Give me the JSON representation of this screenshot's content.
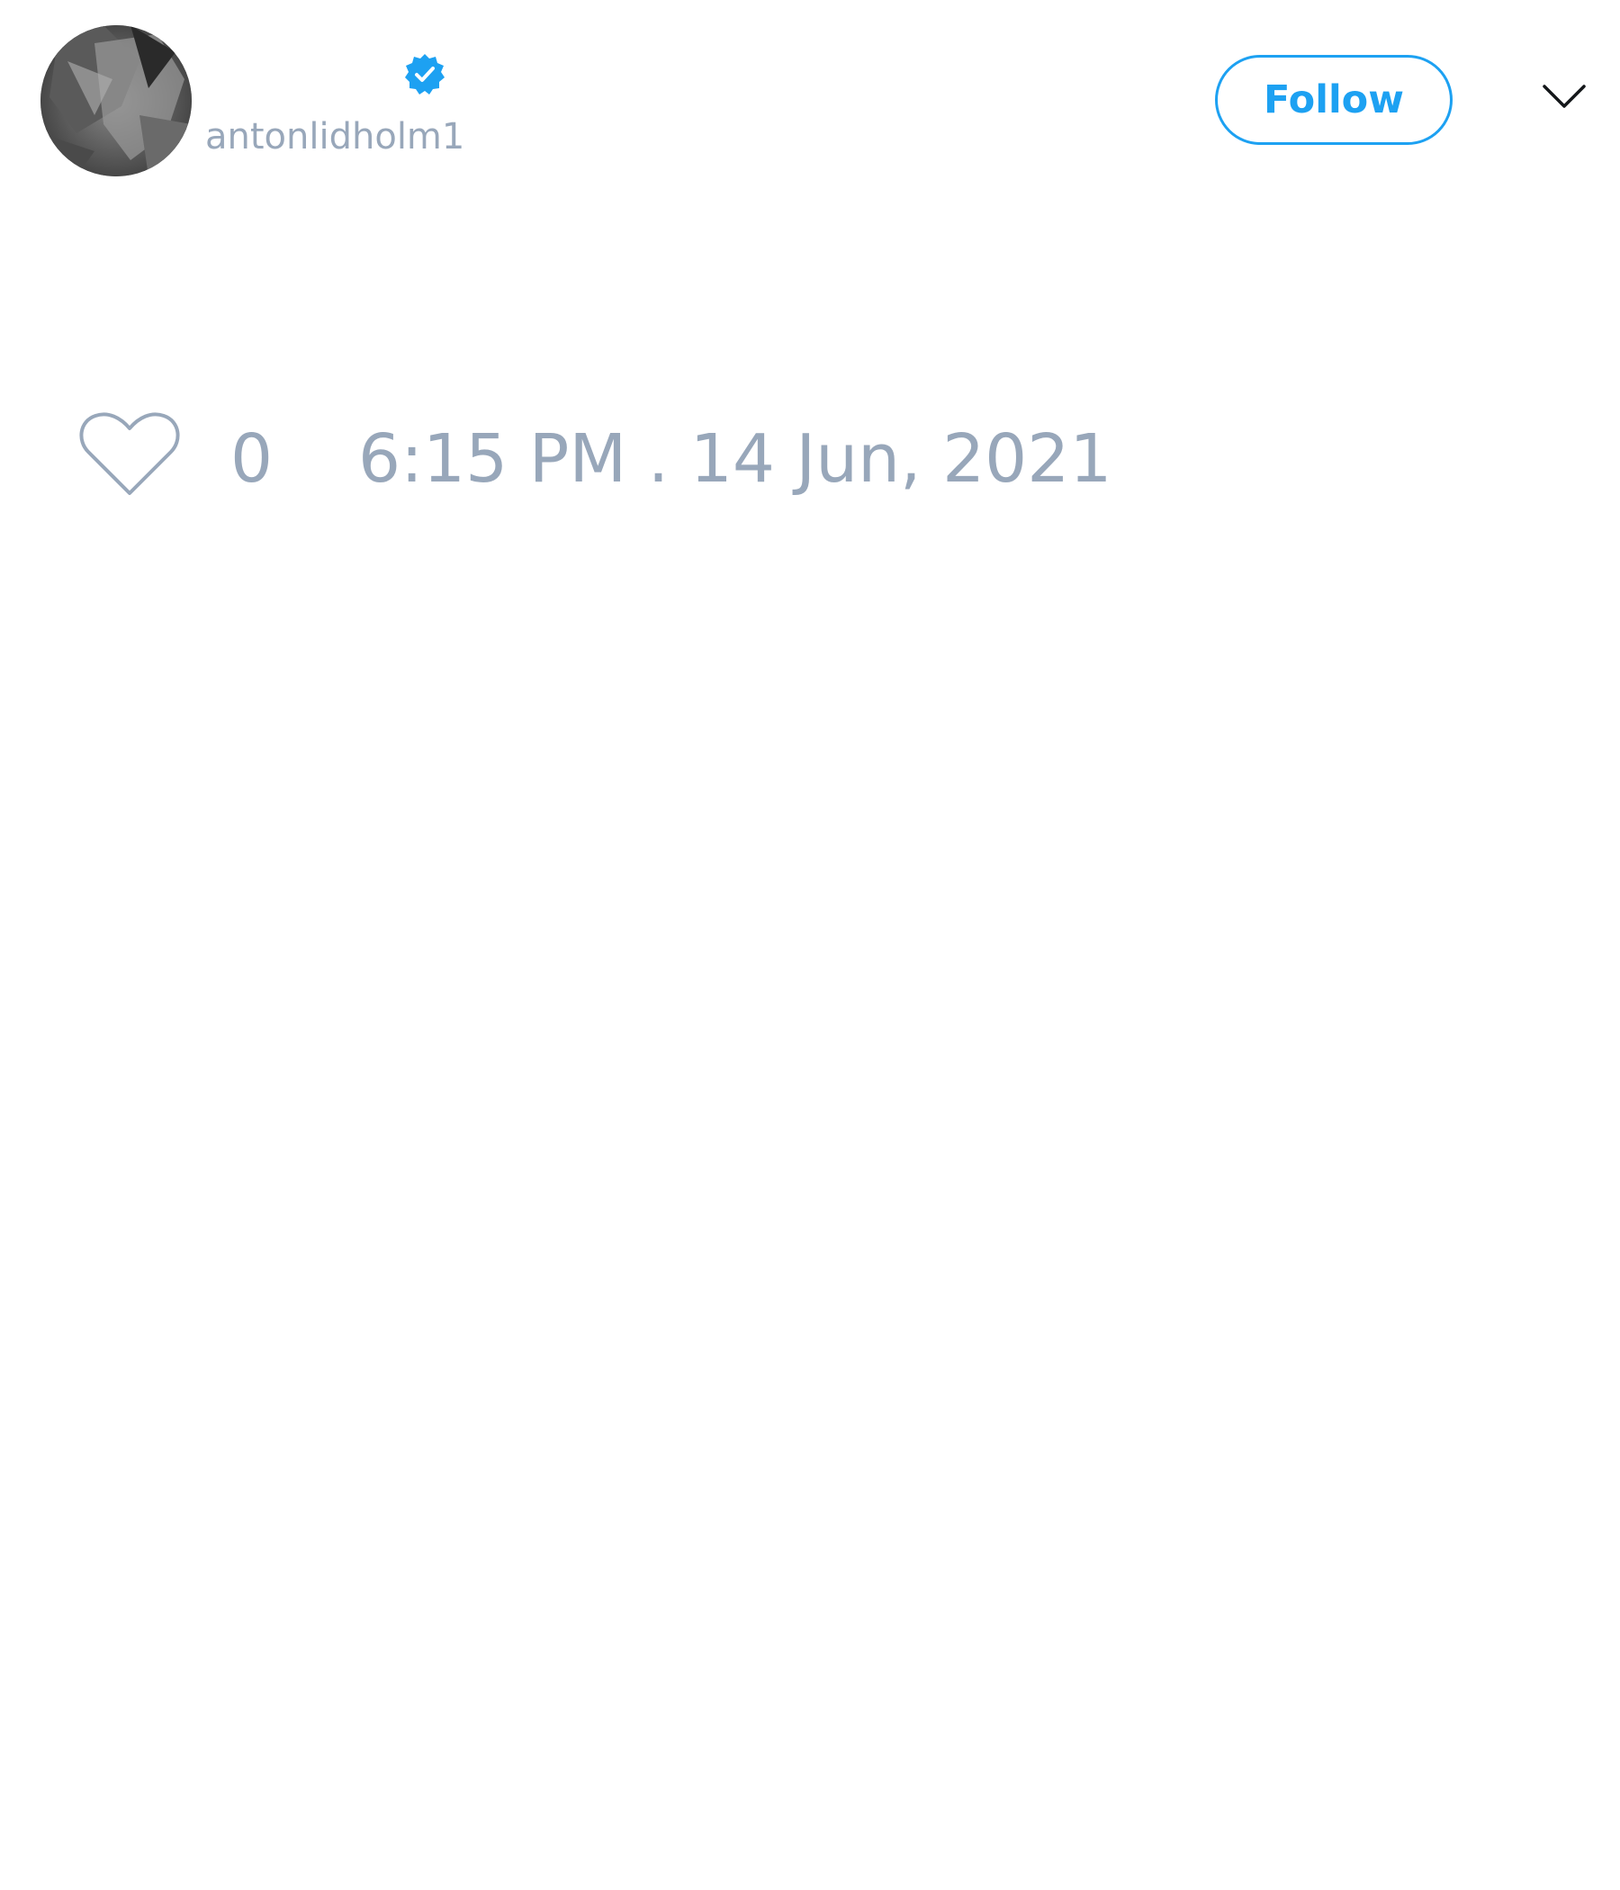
{
  "user": {
    "display_name": "",
    "handle": "antonlidholm1",
    "verified": true,
    "avatar_icon": "avatar-photo"
  },
  "header": {
    "follow_label": "Follow",
    "menu_icon": "chevron-down-icon"
  },
  "tweet": {
    "like_icon": "heart-outline-icon",
    "like_count": "0",
    "timestamp": "6:15 PM . 14 Jun, 2021"
  },
  "colors": {
    "accent": "#1da1f2",
    "muted_text": "#98a7ba",
    "background": "#ffffff"
  }
}
